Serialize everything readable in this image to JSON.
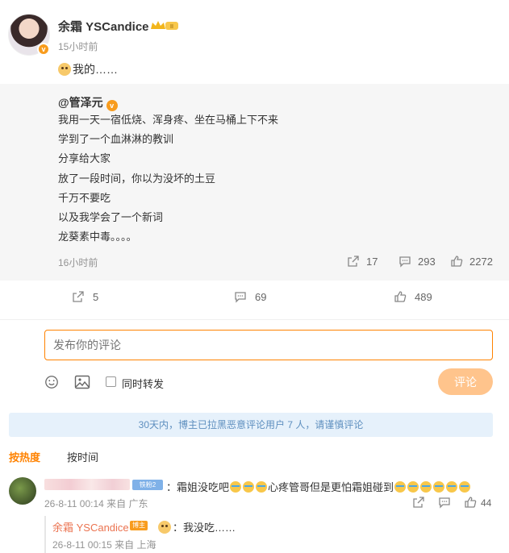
{
  "post": {
    "author": "余霜 YSCandice",
    "time": "15小时前",
    "text": "我的……",
    "repost": {
      "author": "@管泽元",
      "lines": [
        "我用一天一宿低烧、浑身疼、坐在马桶上下不来",
        "学到了一个血淋淋的教训",
        "分享给大家",
        "放了一段时间，你以为没坏的土豆",
        "千万不要吃",
        "以及我学会了一个新词",
        "龙葵素中毒。。。。"
      ],
      "time": "16小时前",
      "shares": "17",
      "comments": "293",
      "likes": "2272"
    },
    "shares": "5",
    "comments": "69",
    "likes": "489"
  },
  "composer": {
    "placeholder": "发布你的评论",
    "repost_label": "同时转发",
    "submit_label": "评论"
  },
  "notice": "30天内，博主已拉黑恶意评论用户 7 人，请谨慎评论",
  "sort": {
    "hot": "按热度",
    "time": "按时间"
  },
  "comment": {
    "fan_badge": "铁粉2",
    "text_a": "：霜姐没吃吧",
    "text_b": "心疼管哥但是更怕霜姐碰到",
    "meta": "26-8-11 00:14 来自 广东",
    "likes": "44",
    "reply": {
      "author": "余霜 YSCandice",
      "badge": "博主",
      "text": "：我没吃……",
      "meta": "26-8-11 00:15 来自 上海"
    }
  },
  "colors": {
    "accent": "#ff8200",
    "link": "#eb7350",
    "notice_bg": "#e6f1fb"
  }
}
